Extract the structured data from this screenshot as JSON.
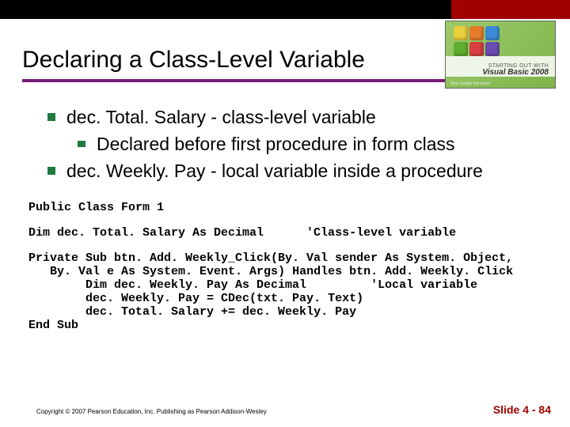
{
  "logo": {
    "small": "STARTING OUT WITH",
    "brand": "Visual Basic 2008",
    "sub": "Tony Gaddis   Kip Irvine"
  },
  "title": "Declaring a Class-Level Variable",
  "bullets": {
    "b1": "dec. Total. Salary - class-level variable",
    "b1a": "Declared before first procedure in form class",
    "b2": "dec. Weekly. Pay - local variable inside a procedure"
  },
  "code": {
    "l1": "Public Class Form 1",
    "l2": "Dim dec. Total. Salary As Decimal      'Class-level variable",
    "l3": "Private Sub btn. Add. Weekly_Click(By. Val sender As System. Object,",
    "l4": "   By. Val e As System. Event. Args) Handles btn. Add. Weekly. Click",
    "l5": "        Dim dec. Weekly. Pay As Decimal         'Local variable",
    "l6": "        dec. Weekly. Pay = CDec(txt. Pay. Text)",
    "l7": "        dec. Total. Salary += dec. Weekly. Pay",
    "l8": "End Sub"
  },
  "footer": {
    "copyright": "Copyright © 2007 Pearson Education, Inc. Publishing as Pearson Addison-Wesley",
    "slide": "Slide 4 - 84"
  }
}
